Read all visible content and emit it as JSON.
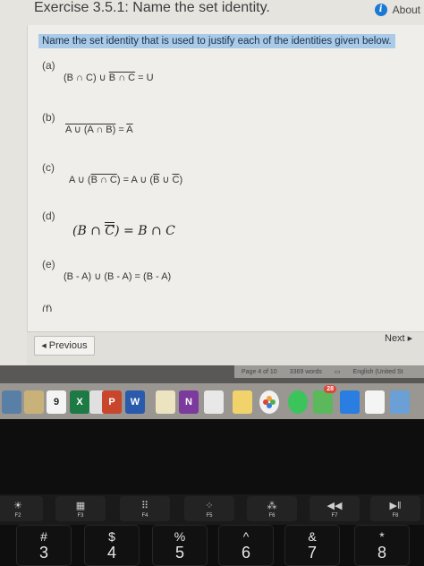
{
  "window": {
    "title": "Exercise 3.5.1: Name the set identity.",
    "about_label": "About"
  },
  "question": {
    "instruction": "Name the set identity that is used to justify each of the identities given below.",
    "items": [
      {
        "label": "(a)",
        "lhs": "(B ∩ C) ∪ ",
        "neg": "B ∩ C",
        "rhs": " = U"
      },
      {
        "label": "(b)",
        "neg_all": "A ∪ (A ∩ B)",
        "eq": " = ",
        "neg_r": "A"
      },
      {
        "label": "(c)",
        "p1": "A ∪ (",
        "neg1": "B ∩ C",
        "p2": ") = A ∪ (",
        "neg2": "B",
        "p3": " ∪ ",
        "neg3": "C",
        "p4": ")"
      },
      {
        "label": "(d)",
        "p1": "(B ∩ ",
        "dneg": "C",
        "p2": ") = B ∩ C"
      },
      {
        "label": "(e)",
        "text": "(B - A) ∪ (B - A) = (B - A)"
      },
      {
        "label": "(f)"
      }
    ]
  },
  "navigation": {
    "previous_label": "Previous",
    "next_label": "Next"
  },
  "status_bar": {
    "page": "Page 4 of 10",
    "words": "3369 words",
    "language": "English (United St"
  },
  "dock": {
    "calendar_day": "9",
    "excel": "X",
    "powerpoint": "P",
    "word": "W",
    "onenote": "N",
    "badge": "28"
  },
  "touchbar": [
    "F2",
    "F3",
    "F4",
    "F5",
    "F6",
    "F7",
    "F8"
  ],
  "keys": [
    {
      "sym": "#",
      "num": "3"
    },
    {
      "sym": "$",
      "num": "4"
    },
    {
      "sym": "%",
      "num": "5"
    },
    {
      "sym": "^",
      "num": "6"
    },
    {
      "sym": "&",
      "num": "7"
    },
    {
      "sym": "*",
      "num": "8"
    }
  ]
}
